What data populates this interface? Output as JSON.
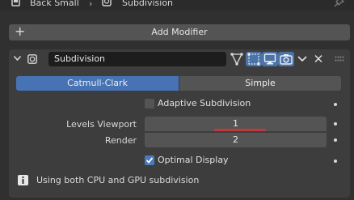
{
  "header": {
    "object_name": "Back Small",
    "modifier_name": "Subdivision"
  },
  "add_modifier": {
    "label": "Add Modifier",
    "icon": "plus-icon"
  },
  "modifier": {
    "name": "Subdivision",
    "icons": [
      "subdivision-wrench-icon",
      "edit-mode-icon",
      "on-cage-icon",
      "viewport-monitor-icon",
      "render-camera-icon",
      "chevron-down-icon",
      "close-icon",
      "drag-handle-icon"
    ],
    "tabs": [
      {
        "label": "Catmull-Clark",
        "active": true
      },
      {
        "label": "Simple",
        "active": false
      }
    ],
    "adaptive_subdivision": {
      "label": "Adaptive Subdivision",
      "checked": false
    },
    "levels": {
      "viewport_label": "Levels Viewport",
      "viewport_value": "1",
      "render_label": "Render",
      "render_value": "2"
    },
    "optimal_display": {
      "label": "Optimal Display",
      "checked": true
    },
    "info": "Using both CPU and GPU subdivision"
  },
  "colors": {
    "background": "#303030",
    "panel": "#3d3d3d",
    "accent": "#4772b3",
    "field": "#545454",
    "highlight_underline": "#c0393b"
  }
}
